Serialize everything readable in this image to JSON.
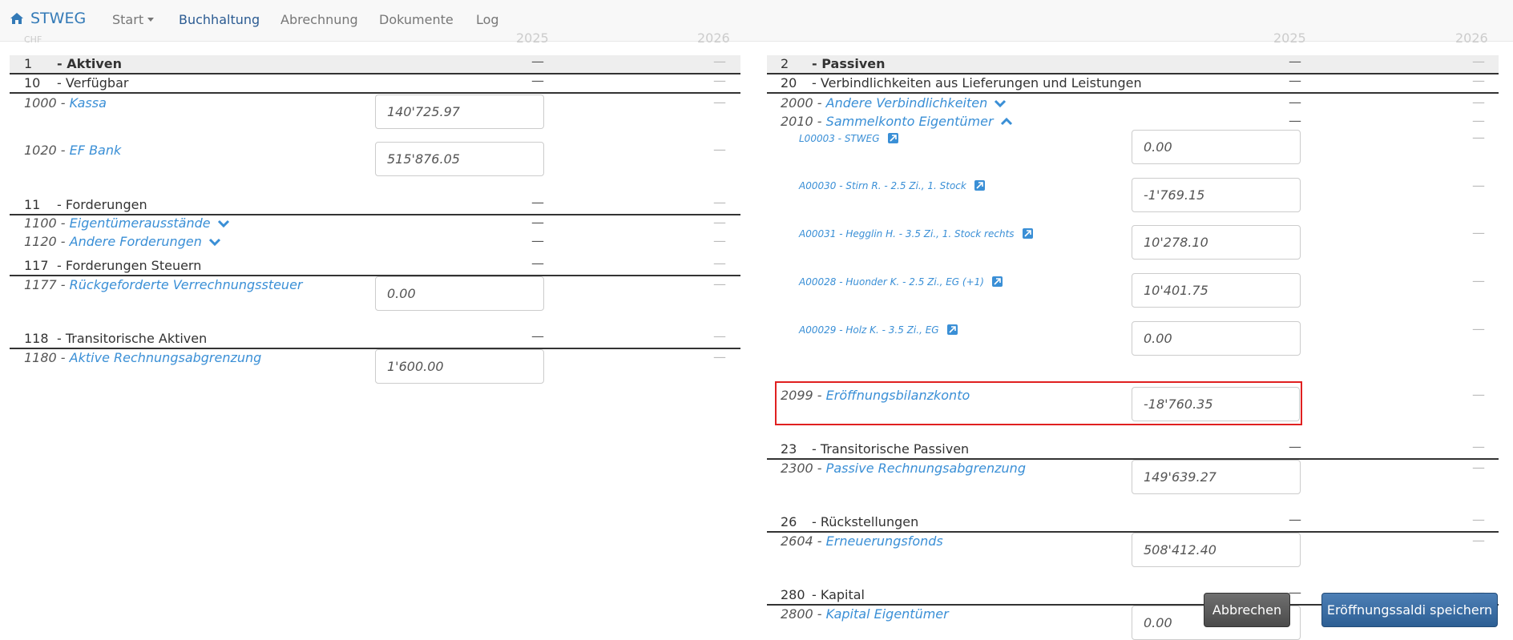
{
  "brand": {
    "label": "STWEG",
    "icon": "home-icon"
  },
  "nav": {
    "start": "Start",
    "buchhaltung": "Buchhaltung",
    "abrechnung": "Abrechnung",
    "dokumente": "Dokumente",
    "log": "Log"
  },
  "columns": {
    "currency": "CHF",
    "year1": "2025",
    "year2": "2026"
  },
  "dash": "—",
  "aktiven": {
    "group": {
      "num": "1",
      "label": "Aktiven"
    },
    "g10": {
      "num": "10",
      "label": "Verfügbar"
    },
    "a1000": {
      "code": "1000 - ",
      "name": "Kassa",
      "value": "140'725.97"
    },
    "a1020": {
      "code": "1020 - ",
      "name": "EF Bank",
      "value": "515'876.05"
    },
    "g11": {
      "num": "11",
      "label": "Forderungen"
    },
    "a1100": {
      "code": "1100 - ",
      "name": "Eigentümerausstände"
    },
    "a1120": {
      "code": "1120 - ",
      "name": "Andere Forderungen"
    },
    "g117": {
      "num": "117",
      "label": "Forderungen Steuern"
    },
    "a1177": {
      "code": "1177 - ",
      "name": "Rückgeforderte Verrechnungssteuer",
      "value": "0.00"
    },
    "g118": {
      "num": "118",
      "label": "Transitorische Aktiven"
    },
    "a1180": {
      "code": "1180 - ",
      "name": "Aktive Rechnungsabgrenzung",
      "value": "1'600.00"
    }
  },
  "passiven": {
    "group": {
      "num": "2",
      "label": "Passiven"
    },
    "g20": {
      "num": "20",
      "label": "Verbindlichkeiten aus Lieferungen und Leistungen"
    },
    "a2000": {
      "code": "2000 - ",
      "name": "Andere Verbindlichkeiten"
    },
    "a2010": {
      "code": "2010 - ",
      "name": "Sammelkonto Eigentümer"
    },
    "owners": [
      {
        "label": "L00003 - STWEG",
        "value": "0.00"
      },
      {
        "label": "A00030 - Stirn R. - 2.5 Zi., 1. Stock",
        "value": "-1'769.15"
      },
      {
        "label": "A00031 - Hegglin H. - 3.5 Zi., 1. Stock rechts",
        "value": "10'278.10"
      },
      {
        "label": "A00028 - Huonder K. - 2.5 Zi., EG (+1)",
        "value": "10'401.75"
      },
      {
        "label": "A00029 - Holz K. - 3.5 Zi., EG",
        "value": "0.00"
      }
    ],
    "a2099": {
      "code": "2099 - ",
      "name": "Eröffnungsbilanzkonto",
      "value": "-18'760.35"
    },
    "g23": {
      "num": "23",
      "label": "Transitorische Passiven"
    },
    "a2300": {
      "code": "2300 - ",
      "name": "Passive Rechnungsabgrenzung",
      "value": "149'639.27"
    },
    "g26": {
      "num": "26",
      "label": "Rückstellungen"
    },
    "a2604": {
      "code": "2604 - ",
      "name": "Erneuerungsfonds",
      "value": "508'412.40"
    },
    "g280": {
      "num": "280",
      "label": "Kapital"
    },
    "a2800": {
      "code": "2800 - ",
      "name": "Kapital Eigentümer",
      "value": "0.00"
    }
  },
  "buttons": {
    "cancel": "Abbrechen",
    "save": "Eröffnungssaldi speichern"
  }
}
